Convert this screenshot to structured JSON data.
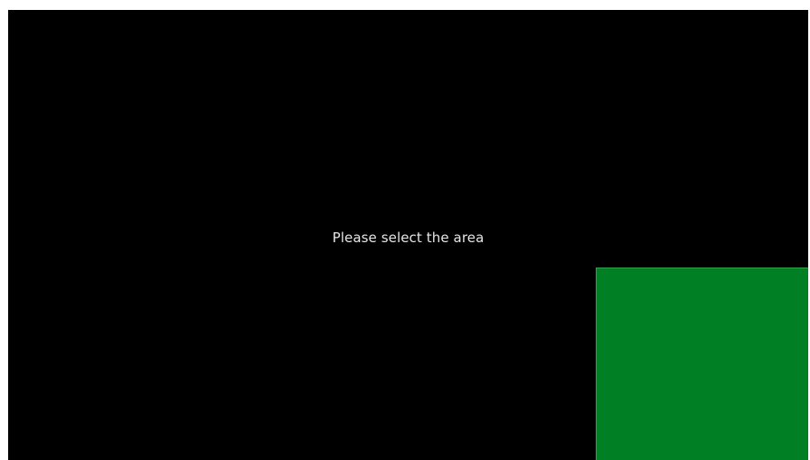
{
  "overlay": {
    "prompt_text": "Please select the area",
    "background_color": "#000000",
    "text_color": "#e6e6e6"
  },
  "selection": {
    "fill_color": "#007f24"
  }
}
